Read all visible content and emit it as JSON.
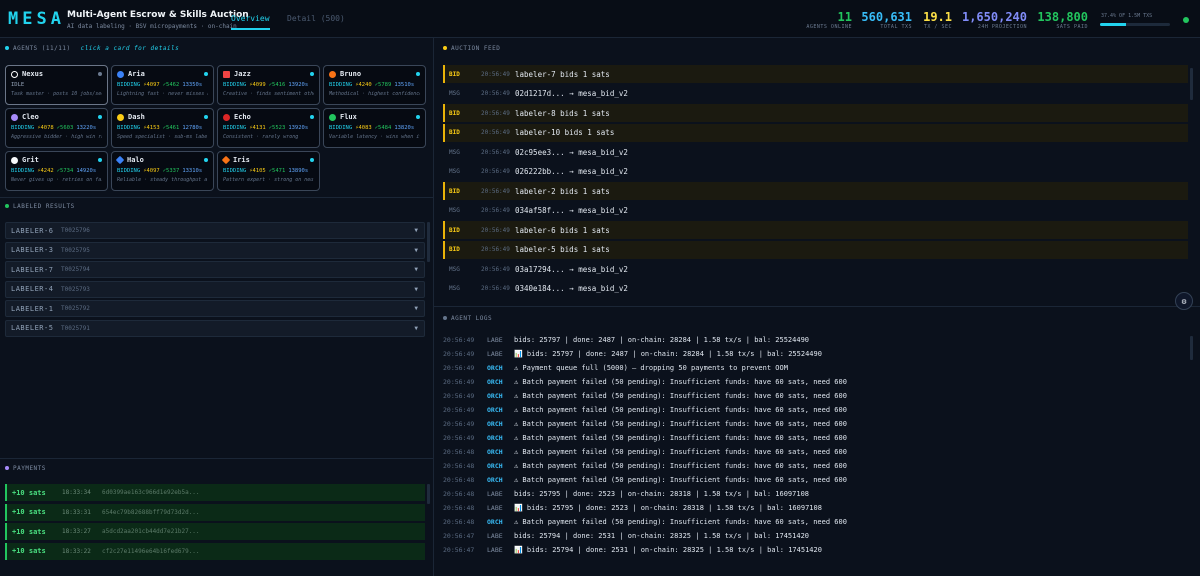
{
  "header": {
    "logo": "MESA",
    "title": "Multi-Agent Escrow & Skills Auction",
    "subtitle": "AI data labeling · BSV micropayments · on-chain",
    "tabs": [
      {
        "label": "Overview",
        "active": true
      },
      {
        "label": "Detail (500)",
        "active": false
      }
    ],
    "stats": [
      {
        "value": "11",
        "label": "AGENTS ONLINE",
        "color": "#22c55e"
      },
      {
        "value": "560,631",
        "label": "TOTAL TXS",
        "color": "#38bdf8"
      },
      {
        "value": "19.1",
        "label": "TX / SEC",
        "color": "#fde047"
      },
      {
        "value": "1,650,240",
        "label": "24H PROJECTION",
        "color": "#818cf8"
      },
      {
        "value": "138,800",
        "label": "SATS PAID",
        "color": "#22c55e"
      }
    ],
    "progress_label": "37.4% OF 1.5M TXS",
    "progress_fraction": 0.374
  },
  "agents_section": {
    "title": "AGENTS (11/11)",
    "hint": "click a card for details"
  },
  "agents": [
    {
      "name": "Nexus",
      "status": "IDLE",
      "desc": "Task master · posts 10 jobs/sec",
      "color": "#ffffff",
      "icon": "ring"
    },
    {
      "name": "Aria",
      "status": "BIDDING",
      "a": "⚡4097",
      "b": "✓5462",
      "c": "13350s",
      "desc": "Lightning fast · never misses a bid",
      "color": "#3b82f6",
      "icon": "circle"
    },
    {
      "name": "Jazz",
      "status": "BIDDING",
      "a": "⚡4099",
      "b": "✓5416",
      "c": "13920s",
      "desc": "Creative · finds sentiment others...",
      "color": "#ef4444",
      "icon": "square"
    },
    {
      "name": "Bruno",
      "status": "BIDDING",
      "a": "⚡4240",
      "b": "✓5789",
      "c": "13510s",
      "desc": "Methodical · highest confidence...",
      "color": "#f97316",
      "icon": "circle"
    },
    {
      "name": "Cleo",
      "status": "BIDDING",
      "a": "⚡4078",
      "b": "✓5603",
      "c": "13220s",
      "desc": "Aggressive bidder · high win rate",
      "color": "#a78bfa",
      "icon": "circle"
    },
    {
      "name": "Dash",
      "status": "BIDDING",
      "a": "⚡4153",
      "b": "✓5461",
      "c": "12780s",
      "desc": "Speed specialist · sub-ms labels",
      "color": "#facc15",
      "icon": "circle"
    },
    {
      "name": "Echo",
      "status": "BIDDING",
      "a": "⚡4131",
      "b": "✓5523",
      "c": "13920s",
      "desc": "Consistent · rarely wrong",
      "color": "#dc2626",
      "icon": "circle"
    },
    {
      "name": "Flux",
      "status": "BIDDING",
      "a": "⚡4083",
      "b": "✓5484",
      "c": "13820s",
      "desc": "Variable latency · wins when it c...",
      "color": "#22c55e",
      "icon": "circle"
    },
    {
      "name": "Grit",
      "status": "BIDDING",
      "a": "⚡4242",
      "b": "✓5734",
      "c": "14920s",
      "desc": "Never gives up · retries on failure",
      "color": "#f8fafc",
      "icon": "circle"
    },
    {
      "name": "Halo",
      "status": "BIDDING",
      "a": "⚡4097",
      "b": "✓5337",
      "c": "13310s",
      "desc": "Reliable · steady throughput all...",
      "color": "#3b82f6",
      "icon": "diamond"
    },
    {
      "name": "Iris",
      "status": "BIDDING",
      "a": "⚡4105",
      "b": "✓5471",
      "c": "13890s",
      "desc": "Pattern expert · strong on neutr...",
      "color": "#f97316",
      "icon": "diamond"
    }
  ],
  "labeled_section": {
    "title": "LABELED RESULTS"
  },
  "labeled_results": [
    {
      "label": "LABELER-6",
      "id": "T0025796"
    },
    {
      "label": "LABELER-3",
      "id": "T0025795"
    },
    {
      "label": "LABELER-7",
      "id": "T0025794"
    },
    {
      "label": "LABELER-4",
      "id": "T0025793"
    },
    {
      "label": "LABELER-1",
      "id": "T0025792"
    },
    {
      "label": "LABELER-5",
      "id": "T0025791"
    }
  ],
  "payments_section": {
    "title": "PAYMENTS"
  },
  "payments": [
    {
      "amount": "+10 sats",
      "time": "18:33:34",
      "tx": "6d0399ae163c966d1e92eb5a..."
    },
    {
      "amount": "+10 sats",
      "time": "18:33:31",
      "tx": "654ec79b82688bff79d73d2d..."
    },
    {
      "amount": "+10 sats",
      "time": "18:33:27",
      "tx": "a5dcd2aa201cb44dd7e21b27..."
    },
    {
      "amount": "+10 sats",
      "time": "18:33:22",
      "tx": "cf2c27e11496e64b16fed679..."
    }
  ],
  "feed_section": {
    "title": "AUCTION FEED"
  },
  "feed": [
    {
      "tag": "BID",
      "time": "20:56:49",
      "text": "labeler-7 bids 1 sats"
    },
    {
      "tag": "MSG",
      "time": "20:56:49",
      "text": "02d1217d... → mesa_bid_v2"
    },
    {
      "tag": "BID",
      "time": "20:56:49",
      "text": "labeler-8 bids 1 sats"
    },
    {
      "tag": "BID",
      "time": "20:56:49",
      "text": "labeler-10 bids 1 sats"
    },
    {
      "tag": "MSG",
      "time": "20:56:49",
      "text": "02c95ee3... → mesa_bid_v2"
    },
    {
      "tag": "MSG",
      "time": "20:56:49",
      "text": "026222bb... → mesa_bid_v2"
    },
    {
      "tag": "BID",
      "time": "20:56:49",
      "text": "labeler-2 bids 1 sats"
    },
    {
      "tag": "MSG",
      "time": "20:56:49",
      "text": "034af58f... → mesa_bid_v2"
    },
    {
      "tag": "BID",
      "time": "20:56:49",
      "text": "labeler-6 bids 1 sats"
    },
    {
      "tag": "BID",
      "time": "20:56:49",
      "text": "labeler-5 bids 1 sats"
    },
    {
      "tag": "MSG",
      "time": "20:56:49",
      "text": "03a17294... → mesa_bid_v2"
    },
    {
      "tag": "MSG",
      "time": "20:56:49",
      "text": "0340e184... → mesa_bid_v2"
    }
  ],
  "logs_section": {
    "title": "AGENT LOGS"
  },
  "logs": [
    {
      "time": "20:56:49",
      "src": "LABE",
      "text": "bids: 25797 | done: 2487 | on-chain: 28284 | 1.58 tx/s | bal: 25524490"
    },
    {
      "time": "20:56:49",
      "src": "LABE",
      "text": "📊 bids: 25797 | done: 2487 | on-chain: 28284 | 1.58 tx/s | bal: 25524490"
    },
    {
      "time": "20:56:49",
      "src": "ORCH",
      "text": "⚠ Payment queue full (5000) — dropping 50 payments to prevent OOM"
    },
    {
      "time": "20:56:49",
      "src": "ORCH",
      "text": "⚠ Batch payment failed (50 pending): Insufficient funds: have 60 sats, need 600"
    },
    {
      "time": "20:56:49",
      "src": "ORCH",
      "text": "⚠ Batch payment failed (50 pending): Insufficient funds: have 60 sats, need 600"
    },
    {
      "time": "20:56:49",
      "src": "ORCH",
      "text": "⚠ Batch payment failed (50 pending): Insufficient funds: have 60 sats, need 600"
    },
    {
      "time": "20:56:49",
      "src": "ORCH",
      "text": "⚠ Batch payment failed (50 pending): Insufficient funds: have 60 sats, need 600"
    },
    {
      "time": "20:56:49",
      "src": "ORCH",
      "text": "⚠ Batch payment failed (50 pending): Insufficient funds: have 60 sats, need 600"
    },
    {
      "time": "20:56:48",
      "src": "ORCH",
      "text": "⚠ Batch payment failed (50 pending): Insufficient funds: have 60 sats, need 600"
    },
    {
      "time": "20:56:48",
      "src": "ORCH",
      "text": "⚠ Batch payment failed (50 pending): Insufficient funds: have 60 sats, need 600"
    },
    {
      "time": "20:56:48",
      "src": "ORCH",
      "text": "⚠ Batch payment failed (50 pending): Insufficient funds: have 60 sats, need 600"
    },
    {
      "time": "20:56:48",
      "src": "LABE",
      "text": "bids: 25795 | done: 2523 | on-chain: 28318 | 1.58 tx/s | bal: 16097108"
    },
    {
      "time": "20:56:48",
      "src": "LABE",
      "text": "📊 bids: 25795 | done: 2523 | on-chain: 28318 | 1.58 tx/s | bal: 16097108"
    },
    {
      "time": "20:56:48",
      "src": "ORCH",
      "text": "⚠ Batch payment failed (50 pending): Insufficient funds: have 60 sats, need 600"
    },
    {
      "time": "20:56:47",
      "src": "LABE",
      "text": "bids: 25794 | done: 2531 | on-chain: 28325 | 1.58 tx/s | bal: 17451420"
    },
    {
      "time": "20:56:47",
      "src": "LABE",
      "text": "📊 bids: 25794 | done: 2531 | on-chain: 28325 | 1.58 tx/s | bal: 17451420"
    }
  ],
  "colors": {
    "accent": "#22d3ee",
    "bid": "#facc15",
    "success": "#22c55e",
    "orch": "#38bdf8"
  }
}
